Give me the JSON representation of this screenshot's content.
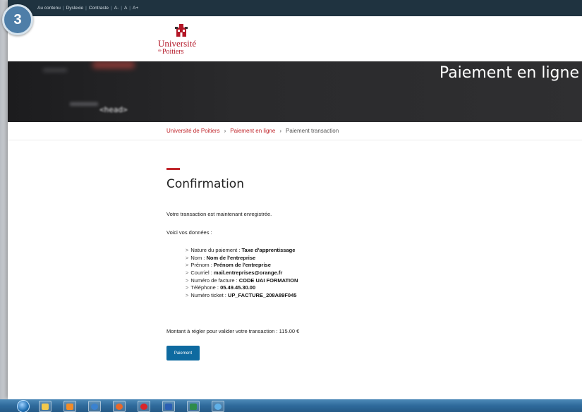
{
  "step_badge": "3",
  "access_bar": {
    "items": [
      "Au contenu",
      "Dyslexie",
      "Contraste",
      "A-",
      "A",
      "A+"
    ]
  },
  "logo": {
    "name": "Université",
    "de": "de",
    "city": "Poitiers"
  },
  "hero": {
    "title": "Paiement en ligne",
    "code_text": "<head>"
  },
  "breadcrumb": {
    "items": [
      "Université de Poitiers",
      "Paiement en ligne",
      "Paiement transaction"
    ],
    "separator": "›"
  },
  "content": {
    "title": "Confirmation",
    "intro": "Votre transaction est maintenant enregistrée.",
    "data_intro": "Voici vos données :",
    "details": [
      {
        "label": "Nature du paiement : ",
        "value": "Taxe d'apprentissage"
      },
      {
        "label": "Nom : ",
        "value": "Nom de l'entreprise"
      },
      {
        "label": "Prénom : ",
        "value": "Prénom de l'entreprise"
      },
      {
        "label": "Courriel : ",
        "value": "mail.entreprises@orange.fr"
      },
      {
        "label": "Numéro de facture : ",
        "value": "CODE UAI FORMATION"
      },
      {
        "label": "Téléphone : ",
        "value": "05.49.45.30.00"
      },
      {
        "label": "Numéro ticket : ",
        "value": "UP_FACTURE_208A89F045"
      }
    ],
    "amount_text": "Montant à régler pour valider votre transaction : 115.00 €",
    "pay_button": "Paiement"
  },
  "colors": {
    "brand_red": "#c1272d",
    "top_bar": "#1f3340",
    "button_blue": "#0e6aa0"
  },
  "taskbar": {
    "icons": [
      "start-orb",
      "explorer-icon",
      "media-player-icon",
      "chrome-icon",
      "firefox-icon",
      "opera-icon",
      "word-icon",
      "excel-icon",
      "ie-icon"
    ]
  }
}
